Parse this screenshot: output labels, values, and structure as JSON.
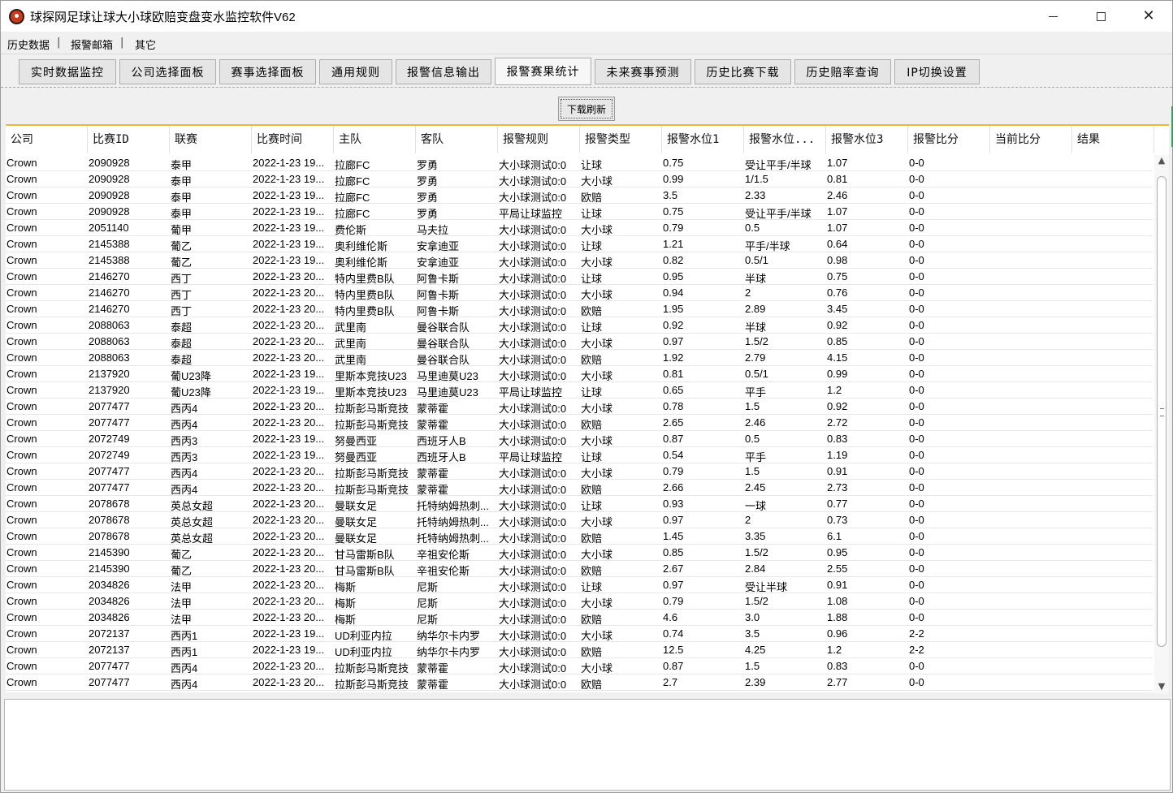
{
  "window": {
    "title": "球探网足球让球大小球欧赔变盘变水监控软件V62"
  },
  "menu": [
    "历史数据",
    "报警邮箱",
    "其它"
  ],
  "menu_sep": "|",
  "tabs": [
    {
      "label": "实时数据监控",
      "active": false
    },
    {
      "label": "公司选择面板",
      "active": false
    },
    {
      "label": "赛事选择面板",
      "active": false
    },
    {
      "label": "通用规则",
      "active": false
    },
    {
      "label": "报警信息输出",
      "active": false
    },
    {
      "label": "报警赛果统计",
      "active": true
    },
    {
      "label": "未来赛事预测",
      "active": false
    },
    {
      "label": "历史比赛下载",
      "active": false
    },
    {
      "label": "历史赔率查询",
      "active": false
    },
    {
      "label": "IP切换设置",
      "active": false
    }
  ],
  "refresh_button": "下载刷新",
  "table": {
    "columns": [
      "公司",
      "比赛ID",
      "联赛",
      "比赛时间",
      "主队",
      "客队",
      "报警规则",
      "报警类型",
      "报警水位1",
      "报警水位...",
      "报警水位3",
      "报警比分",
      "当前比分",
      "结果"
    ],
    "rows": [
      [
        "Crown",
        "2090928",
        "泰甲",
        "2022-1-23 19...",
        "拉廊FC",
        "罗勇",
        "大小球测试0:0",
        "让球",
        "0.75",
        "受让平手/半球",
        "1.07",
        "0-0",
        "",
        ""
      ],
      [
        "Crown",
        "2090928",
        "泰甲",
        "2022-1-23 19...",
        "拉廊FC",
        "罗勇",
        "大小球测试0:0",
        "大小球",
        "0.99",
        "1/1.5",
        "0.81",
        "0-0",
        "",
        ""
      ],
      [
        "Crown",
        "2090928",
        "泰甲",
        "2022-1-23 19...",
        "拉廊FC",
        "罗勇",
        "大小球测试0:0",
        "欧赔",
        "3.5",
        "2.33",
        "2.46",
        "0-0",
        "",
        ""
      ],
      [
        "Crown",
        "2090928",
        "泰甲",
        "2022-1-23 19...",
        "拉廊FC",
        "罗勇",
        "平局让球监控",
        "让球",
        "0.75",
        "受让平手/半球",
        "1.07",
        "0-0",
        "",
        ""
      ],
      [
        "Crown",
        "2051140",
        "葡甲",
        "2022-1-23 19...",
        "费伦斯",
        "马夫拉",
        "大小球测试0:0",
        "大小球",
        "0.79",
        "0.5",
        "1.07",
        "0-0",
        "",
        ""
      ],
      [
        "Crown",
        "2145388",
        "葡乙",
        "2022-1-23 19...",
        "奥利维伦斯",
        "安拿迪亚",
        "大小球测试0:0",
        "让球",
        "1.21",
        "平手/半球",
        "0.64",
        "0-0",
        "",
        ""
      ],
      [
        "Crown",
        "2145388",
        "葡乙",
        "2022-1-23 19...",
        "奥利维伦斯",
        "安拿迪亚",
        "大小球测试0:0",
        "大小球",
        "0.82",
        "0.5/1",
        "0.98",
        "0-0",
        "",
        ""
      ],
      [
        "Crown",
        "2146270",
        "西丁",
        "2022-1-23 20...",
        "特内里费B队",
        "阿鲁卡斯",
        "大小球测试0:0",
        "让球",
        "0.95",
        "半球",
        "0.75",
        "0-0",
        "",
        ""
      ],
      [
        "Crown",
        "2146270",
        "西丁",
        "2022-1-23 20...",
        "特内里费B队",
        "阿鲁卡斯",
        "大小球测试0:0",
        "大小球",
        "0.94",
        "2",
        "0.76",
        "0-0",
        "",
        ""
      ],
      [
        "Crown",
        "2146270",
        "西丁",
        "2022-1-23 20...",
        "特内里费B队",
        "阿鲁卡斯",
        "大小球测试0:0",
        "欧赔",
        "1.95",
        "2.89",
        "3.45",
        "0-0",
        "",
        ""
      ],
      [
        "Crown",
        "2088063",
        "泰超",
        "2022-1-23 20...",
        "武里南",
        "曼谷联合队",
        "大小球测试0:0",
        "让球",
        "0.92",
        "半球",
        "0.92",
        "0-0",
        "",
        ""
      ],
      [
        "Crown",
        "2088063",
        "泰超",
        "2022-1-23 20...",
        "武里南",
        "曼谷联合队",
        "大小球测试0:0",
        "大小球",
        "0.97",
        "1.5/2",
        "0.85",
        "0-0",
        "",
        ""
      ],
      [
        "Crown",
        "2088063",
        "泰超",
        "2022-1-23 20...",
        "武里南",
        "曼谷联合队",
        "大小球测试0:0",
        "欧赔",
        "1.92",
        "2.79",
        "4.15",
        "0-0",
        "",
        ""
      ],
      [
        "Crown",
        "2137920",
        "葡U23降",
        "2022-1-23 19...",
        "里斯本竞技U23",
        "马里迪莫U23",
        "大小球测试0:0",
        "大小球",
        "0.81",
        "0.5/1",
        "0.99",
        "0-0",
        "",
        ""
      ],
      [
        "Crown",
        "2137920",
        "葡U23降",
        "2022-1-23 19...",
        "里斯本竞技U23",
        "马里迪莫U23",
        "平局让球监控",
        "让球",
        "0.65",
        "平手",
        "1.2",
        "0-0",
        "",
        ""
      ],
      [
        "Crown",
        "2077477",
        "西丙4",
        "2022-1-23 20...",
        "拉斯彭马斯竞技",
        "蒙蒂霍",
        "大小球测试0:0",
        "大小球",
        "0.78",
        "1.5",
        "0.92",
        "0-0",
        "",
        ""
      ],
      [
        "Crown",
        "2077477",
        "西丙4",
        "2022-1-23 20...",
        "拉斯彭马斯竞技",
        "蒙蒂霍",
        "大小球测试0:0",
        "欧赔",
        "2.65",
        "2.46",
        "2.72",
        "0-0",
        "",
        ""
      ],
      [
        "Crown",
        "2072749",
        "西丙3",
        "2022-1-23 19...",
        "努曼西亚",
        "西班牙人B",
        "大小球测试0:0",
        "大小球",
        "0.87",
        "0.5",
        "0.83",
        "0-0",
        "",
        ""
      ],
      [
        "Crown",
        "2072749",
        "西丙3",
        "2022-1-23 19...",
        "努曼西亚",
        "西班牙人B",
        "平局让球监控",
        "让球",
        "0.54",
        "平手",
        "1.19",
        "0-0",
        "",
        ""
      ],
      [
        "Crown",
        "2077477",
        "西丙4",
        "2022-1-23 20...",
        "拉斯彭马斯竞技",
        "蒙蒂霍",
        "大小球测试0:0",
        "大小球",
        "0.79",
        "1.5",
        "0.91",
        "0-0",
        "",
        ""
      ],
      [
        "Crown",
        "2077477",
        "西丙4",
        "2022-1-23 20...",
        "拉斯彭马斯竞技",
        "蒙蒂霍",
        "大小球测试0:0",
        "欧赔",
        "2.66",
        "2.45",
        "2.73",
        "0-0",
        "",
        ""
      ],
      [
        "Crown",
        "2078678",
        "英总女超",
        "2022-1-23 20...",
        "曼联女足",
        "托特纳姆热刺...",
        "大小球测试0:0",
        "让球",
        "0.93",
        "一球",
        "0.77",
        "0-0",
        "",
        ""
      ],
      [
        "Crown",
        "2078678",
        "英总女超",
        "2022-1-23 20...",
        "曼联女足",
        "托特纳姆热刺...",
        "大小球测试0:0",
        "大小球",
        "0.97",
        "2",
        "0.73",
        "0-0",
        "",
        ""
      ],
      [
        "Crown",
        "2078678",
        "英总女超",
        "2022-1-23 20...",
        "曼联女足",
        "托特纳姆热刺...",
        "大小球测试0:0",
        "欧赔",
        "1.45",
        "3.35",
        "6.1",
        "0-0",
        "",
        ""
      ],
      [
        "Crown",
        "2145390",
        "葡乙",
        "2022-1-23 20...",
        "甘马雷斯B队",
        "辛祖安伦斯",
        "大小球测试0:0",
        "大小球",
        "0.85",
        "1.5/2",
        "0.95",
        "0-0",
        "",
        ""
      ],
      [
        "Crown",
        "2145390",
        "葡乙",
        "2022-1-23 20...",
        "甘马雷斯B队",
        "辛祖安伦斯",
        "大小球测试0:0",
        "欧赔",
        "2.67",
        "2.84",
        "2.55",
        "0-0",
        "",
        ""
      ],
      [
        "Crown",
        "2034826",
        "法甲",
        "2022-1-23 20...",
        "梅斯",
        "尼斯",
        "大小球测试0:0",
        "让球",
        "0.97",
        "受让半球",
        "0.91",
        "0-0",
        "",
        ""
      ],
      [
        "Crown",
        "2034826",
        "法甲",
        "2022-1-23 20...",
        "梅斯",
        "尼斯",
        "大小球测试0:0",
        "大小球",
        "0.79",
        "1.5/2",
        "1.08",
        "0-0",
        "",
        ""
      ],
      [
        "Crown",
        "2034826",
        "法甲",
        "2022-1-23 20...",
        "梅斯",
        "尼斯",
        "大小球测试0:0",
        "欧赔",
        "4.6",
        "3.0",
        "1.88",
        "0-0",
        "",
        ""
      ],
      [
        "Crown",
        "2072137",
        "西丙1",
        "2022-1-23 19...",
        "UD利亚内拉",
        "纳华尔卡内罗",
        "大小球测试0:0",
        "大小球",
        "0.74",
        "3.5",
        "0.96",
        "2-2",
        "",
        ""
      ],
      [
        "Crown",
        "2072137",
        "西丙1",
        "2022-1-23 19...",
        "UD利亚内拉",
        "纳华尔卡内罗",
        "大小球测试0:0",
        "欧赔",
        "12.5",
        "4.25",
        "1.2",
        "2-2",
        "",
        ""
      ],
      [
        "Crown",
        "2077477",
        "西丙4",
        "2022-1-23 20...",
        "拉斯彭马斯竞技",
        "蒙蒂霍",
        "大小球测试0:0",
        "大小球",
        "0.87",
        "1.5",
        "0.83",
        "0-0",
        "",
        ""
      ],
      [
        "Crown",
        "2077477",
        "西丙4",
        "2022-1-23 20...",
        "拉斯彭马斯竞技",
        "蒙蒂霍",
        "大小球测试0:0",
        "欧赔",
        "2.7",
        "2.39",
        "2.77",
        "0-0",
        "",
        ""
      ]
    ]
  },
  "icons": {
    "app": "app-logo-icon",
    "scroll_up": "▲",
    "scroll_down": "▼",
    "close": "✕"
  },
  "colors": {
    "header_accent": "#f2b43c"
  }
}
